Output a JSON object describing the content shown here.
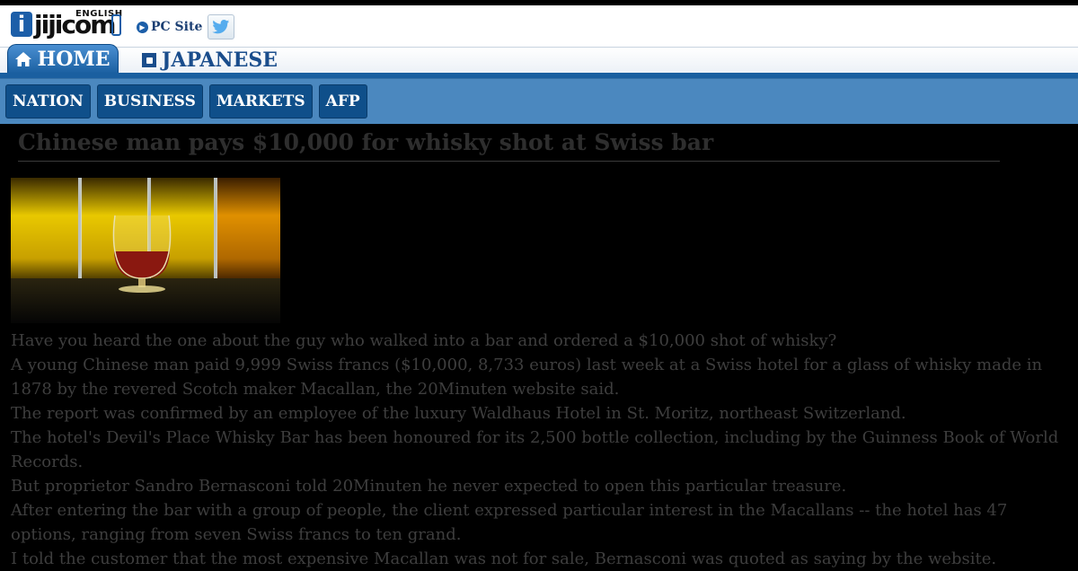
{
  "header": {
    "logo_letter": "i",
    "logo_word": "jijicom",
    "logo_english": "ENGLISH",
    "pc_site_label": "PC Site",
    "twitter_icon": "twitter-bird-icon"
  },
  "nav_primary": {
    "home_label": "HOME",
    "japanese_label": "JAPANESE"
  },
  "nav_secondary": [
    {
      "label": "NATION"
    },
    {
      "label": "BUSINESS"
    },
    {
      "label": "MARKETS"
    },
    {
      "label": "AFP"
    }
  ],
  "article": {
    "title": "Chinese man pays $10,000 for whisky shot at Swiss bar",
    "paragraphs": [
      "Have you heard the one about the guy who walked into a bar and ordered a $10,000 shot of whisky?",
      "A young Chinese man paid 9,999 Swiss francs ($10,000, 8,733 euros) last week at a Swiss hotel for a glass of whisky made in 1878 by the revered Scotch maker Macallan, the 20Minuten website said.",
      "The report was confirmed by an employee of the luxury Waldhaus Hotel in St. Moritz, northeast Switzerland.",
      "The hotel's Devil's Place Whisky Bar has been honoured for its 2,500 bottle collection, including by the Guinness Book of World Records.",
      "But proprietor Sandro Bernasconi told 20Minuten he never expected to open this particular treasure.",
      "After entering the bar with a group of people, the client expressed particular interest in the Macallans -- the hotel has 47 options, ranging from seven Swiss francs to ten grand.",
      "I told the customer that the most expensive Macallan was not for sale, Bernasconi was quoted as saying by the website."
    ]
  },
  "colors": {
    "brand_blue": "#1a5fa0",
    "nav_bar": "#4b88bf",
    "pill": "#0f4f8a"
  }
}
